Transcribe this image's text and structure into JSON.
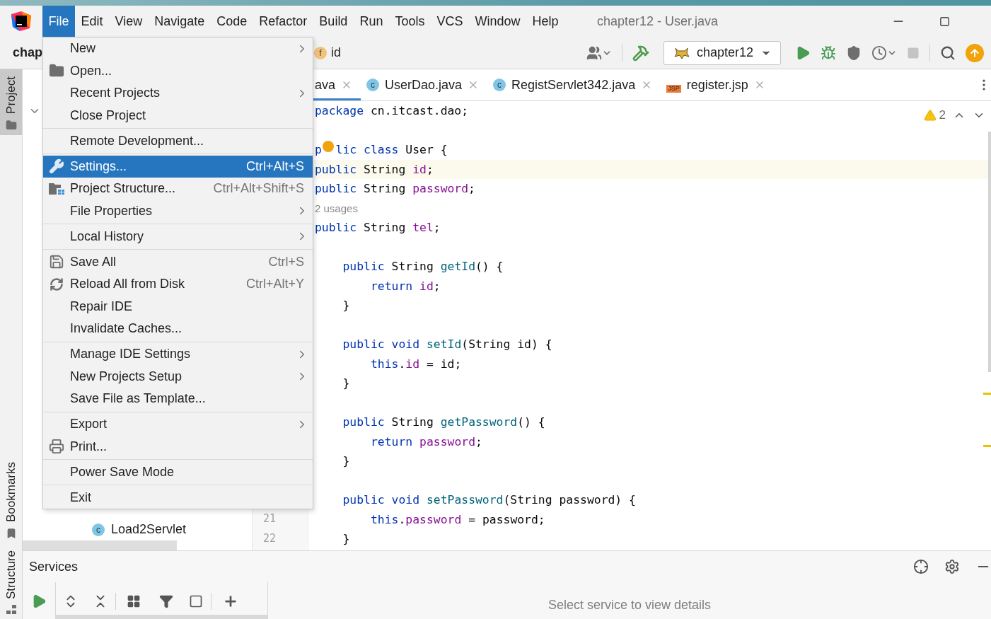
{
  "title_bar": {
    "menus": [
      {
        "label": "File",
        "selected": true
      },
      {
        "label": "Edit",
        "selected": false
      },
      {
        "label": "View",
        "selected": false
      },
      {
        "label": "Navigate",
        "selected": false
      },
      {
        "label": "Code",
        "selected": false
      },
      {
        "label": "Refactor",
        "selected": false
      },
      {
        "label": "Build",
        "selected": false
      },
      {
        "label": "Run",
        "selected": false
      },
      {
        "label": "Tools",
        "selected": false
      },
      {
        "label": "VCS",
        "selected": false
      },
      {
        "label": "Window",
        "selected": false
      },
      {
        "label": "Help",
        "selected": false
      }
    ],
    "title": "chapter12 - User.java"
  },
  "toolbar": {
    "project": "chap",
    "breadcrumb": {
      "badge": "f",
      "label": "id"
    },
    "run_config": "chapter12"
  },
  "tool_windows": [
    {
      "label": "Project",
      "selected": true
    },
    {
      "label": "Bookmarks",
      "selected": false
    },
    {
      "label": "Structure",
      "selected": false
    }
  ],
  "project_tree": [
    {
      "badge": "c",
      "label": "Load2Servlet"
    }
  ],
  "gutter": [
    "21",
    "22"
  ],
  "tabs": [
    {
      "label": "ava",
      "kind": "partial",
      "selected": true
    },
    {
      "label": "UserDao.java",
      "kind": "class",
      "badge": "c",
      "selected": false
    },
    {
      "label": "RegistServlet342.java",
      "kind": "class",
      "badge": "c",
      "selected": false
    },
    {
      "label": "register.jsp",
      "kind": "jsp",
      "badge": "JSP",
      "selected": false
    }
  ],
  "editor": {
    "warnings": "2",
    "lines": [
      {
        "kind": "top",
        "highlighted": false,
        "tokens": [
          {
            "text": "package ",
            "kind": "keyword"
          },
          {
            "text": "cn.itcast.dao;",
            "kind": "plain"
          }
        ]
      },
      {
        "kind": "blank",
        "highlighted": false
      },
      {
        "kind": "top",
        "highlighted": false,
        "tokens": [
          {
            "text": "p",
            "kind": "keyword"
          },
          {
            "kind": "bulb"
          },
          {
            "text": "lic ",
            "kind": "keyword"
          },
          {
            "text": "class ",
            "kind": "keyword"
          },
          {
            "text": "User {",
            "kind": "plain"
          }
        ]
      },
      {
        "kind": "top",
        "highlighted": true,
        "tokens": [
          {
            "text": "public ",
            "kind": "keyword"
          },
          {
            "text": "String ",
            "kind": "plain"
          },
          {
            "text": "id",
            "kind": "field"
          },
          {
            "text": ";",
            "kind": "plain"
          }
        ]
      },
      {
        "kind": "top",
        "highlighted": false,
        "tokens": [
          {
            "text": "public ",
            "kind": "keyword"
          },
          {
            "text": "String ",
            "kind": "plain"
          },
          {
            "text": "password",
            "kind": "field"
          },
          {
            "text": ";",
            "kind": "plain"
          }
        ]
      },
      {
        "kind": "hint",
        "highlighted": false,
        "text": "2 usages"
      },
      {
        "kind": "top",
        "highlighted": false,
        "tokens": [
          {
            "text": "public ",
            "kind": "keyword"
          },
          {
            "text": "String ",
            "kind": "plain"
          },
          {
            "text": "tel",
            "kind": "field"
          },
          {
            "text": ";",
            "kind": "plain"
          }
        ]
      },
      {
        "kind": "blank",
        "highlighted": false
      },
      {
        "kind": "member",
        "highlighted": false,
        "tokens": [
          {
            "text": "public ",
            "kind": "keyword"
          },
          {
            "text": "String ",
            "kind": "plain"
          },
          {
            "text": "getId",
            "kind": "method"
          },
          {
            "text": "() {",
            "kind": "plain"
          }
        ]
      },
      {
        "kind": "body",
        "highlighted": false,
        "tokens": [
          {
            "text": "return ",
            "kind": "keyword"
          },
          {
            "text": "id",
            "kind": "field"
          },
          {
            "text": ";",
            "kind": "plain"
          }
        ]
      },
      {
        "kind": "member",
        "highlighted": false,
        "tokens": [
          {
            "text": "}",
            "kind": "plain"
          }
        ]
      },
      {
        "kind": "blank",
        "highlighted": false
      },
      {
        "kind": "member",
        "highlighted": false,
        "tokens": [
          {
            "text": "public ",
            "kind": "keyword"
          },
          {
            "text": "void ",
            "kind": "keyword"
          },
          {
            "text": "setId",
            "kind": "method"
          },
          {
            "text": "(String id) {",
            "kind": "plain"
          }
        ]
      },
      {
        "kind": "body",
        "highlighted": false,
        "tokens": [
          {
            "text": "this",
            "kind": "keyword"
          },
          {
            "text": ".",
            "kind": "plain"
          },
          {
            "text": "id",
            "kind": "field"
          },
          {
            "text": " = id;",
            "kind": "plain"
          }
        ]
      },
      {
        "kind": "member",
        "highlighted": false,
        "tokens": [
          {
            "text": "}",
            "kind": "plain"
          }
        ]
      },
      {
        "kind": "blank",
        "highlighted": false
      },
      {
        "kind": "member",
        "highlighted": false,
        "tokens": [
          {
            "text": "public ",
            "kind": "keyword"
          },
          {
            "text": "String ",
            "kind": "plain"
          },
          {
            "text": "getPassword",
            "kind": "method"
          },
          {
            "text": "() {",
            "kind": "plain"
          }
        ]
      },
      {
        "kind": "body",
        "highlighted": false,
        "tokens": [
          {
            "text": "return ",
            "kind": "keyword"
          },
          {
            "text": "password",
            "kind": "field"
          },
          {
            "text": ";",
            "kind": "plain"
          }
        ]
      },
      {
        "kind": "member",
        "highlighted": false,
        "tokens": [
          {
            "text": "}",
            "kind": "plain"
          }
        ]
      },
      {
        "kind": "blank",
        "highlighted": false
      },
      {
        "kind": "member",
        "highlighted": false,
        "tokens": [
          {
            "text": "public ",
            "kind": "keyword"
          },
          {
            "text": "void ",
            "kind": "keyword"
          },
          {
            "text": "setPassword",
            "kind": "method"
          },
          {
            "text": "(String password) {",
            "kind": "plain"
          }
        ]
      },
      {
        "kind": "body",
        "highlighted": false,
        "tokens": [
          {
            "text": "this",
            "kind": "keyword"
          },
          {
            "text": ".",
            "kind": "plain"
          },
          {
            "text": "password",
            "kind": "field"
          },
          {
            "text": " = password;",
            "kind": "plain"
          }
        ]
      },
      {
        "kind": "member",
        "highlighted": false,
        "tokens": [
          {
            "text": "}",
            "kind": "plain"
          }
        ]
      }
    ]
  },
  "file_menu": {
    "groups": [
      [
        {
          "label": "New",
          "submenu": true,
          "selected": false
        },
        {
          "label": "Open...",
          "selected": false
        },
        {
          "label": "Recent Projects",
          "submenu": true,
          "selected": false
        },
        {
          "label": "Close Project",
          "selected": false
        }
      ],
      [
        {
          "label": "Remote Development...",
          "selected": false
        }
      ],
      [
        {
          "label": "Settings...",
          "shortcut": "Ctrl+Alt+S",
          "selected": true
        },
        {
          "label": "Project Structure...",
          "shortcut": "Ctrl+Alt+Shift+S",
          "selected": false
        },
        {
          "label": "File Properties",
          "submenu": true,
          "selected": false
        }
      ],
      [
        {
          "label": "Local History",
          "submenu": true,
          "selected": false
        }
      ],
      [
        {
          "label": "Save All",
          "shortcut": "Ctrl+S",
          "selected": false
        },
        {
          "label": "Reload All from Disk",
          "shortcut": "Ctrl+Alt+Y",
          "selected": false
        },
        {
          "label": "Repair IDE",
          "selected": false
        },
        {
          "label": "Invalidate Caches...",
          "selected": false
        }
      ],
      [
        {
          "label": "Manage IDE Settings",
          "submenu": true,
          "selected": false
        },
        {
          "label": "New Projects Setup",
          "submenu": true,
          "selected": false
        },
        {
          "label": "Save File as Template...",
          "selected": false
        }
      ],
      [
        {
          "label": "Export",
          "submenu": true,
          "selected": false
        },
        {
          "label": "Print...",
          "selected": false
        }
      ],
      [
        {
          "label": "Power Save Mode",
          "selected": false
        }
      ],
      [
        {
          "label": "Exit",
          "selected": false
        }
      ]
    ]
  },
  "services": {
    "title": "Services",
    "empty_text": "Select service to view details"
  }
}
